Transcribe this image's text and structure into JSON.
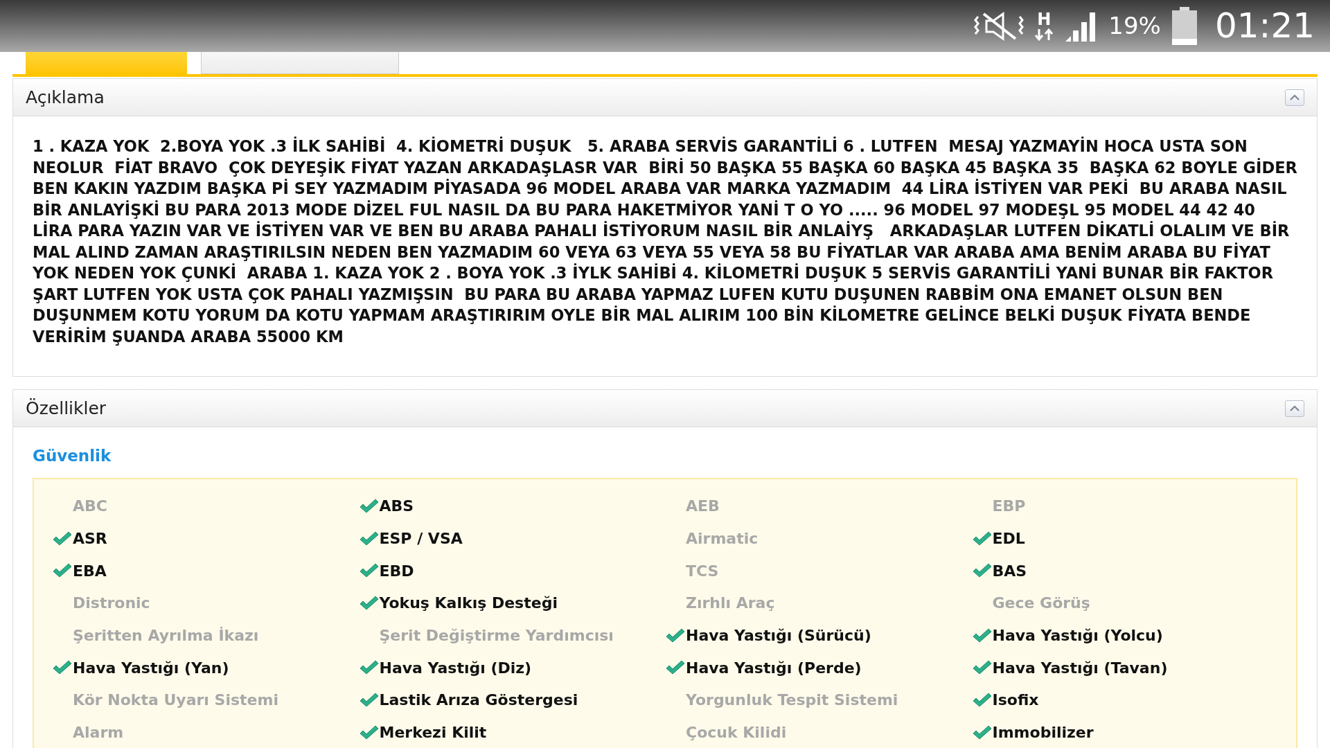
{
  "status_bar": {
    "network": "H",
    "battery": "19%",
    "time": "01:21"
  },
  "tabs": [
    {
      "selected": true
    },
    {
      "selected": false
    }
  ],
  "description": {
    "title": "Açıklama",
    "expanded": true,
    "text": "1 . KAZA YOK  2.BOYA YOK .3 İLK SAHİBİ  4. KİOMETRİ DUŞUK   5. ARABA SERVİS GARANTİLİ 6 . LUTFEN  MESAJ YAZMAYİN HOCA USTA SON NEOLUR  FİAT BRAVO  ÇOK DEYEŞİK FİYAT YAZAN ARKADAŞLASR VAR  BİRİ 50 BAŞKA 55 BAŞKA 60 BAŞKA 45 BAŞKA 35  BAŞKA 62 BOYLE GİDER BEN KAKIN YAZDIM BAŞKA Pİ SEY YAZMADIM PİYASADA 96 MODEL ARABA VAR MARKA YAZMADIM  44 LİRA İSTİYEN VAR PEKİ  BU ARABA NASIL BİR ANLAYİŞKİ BU PARA 2013 MODE DİZEL FUL NASIL DA BU PARA HAKETMİYOR YANİ T O YO ..... 96 MODEL 97 MODEŞL 95 MODEL 44 42 40 LİRA PARA YAZIN VAR VE İSTİYEN VAR VE BEN BU ARABA PAHALI İSTİYORUM NASIL BİR ANLAİYŞ   ARKADAŞLAR LUTFEN DİKATLİ OLALIM VE BİR MAL ALIND ZAMAN ARAŞTIRILSIN NEDEN BEN YAZMADIM 60 VEYA 63 VEYA 55 VEYA 58 BU FİYATLAR VAR ARABA AMA BENİM ARABA BU FİYAT YOK NEDEN YOK ÇUNKİ  ARABA 1. KAZA YOK 2 . BOYA YOK .3 İYLK SAHİBİ 4. KİLOMETRİ DUŞUK 5 SERVİS GARANTİLİ YANİ BUNAR BİR FAKTOR ŞART LUTFEN YOK USTA ÇOK PAHALI YAZMIŞSIN  BU PARA BU ARABA YAPMAZ LUFEN KUTU DUŞUNEN RABBİM ONA EMANET OLSUN BEN DUŞUNMEM KOTU YORUM DA KOTU YAPMAM ARAŞTIRIRIM OYLE BİR MAL ALIRIM 100 BİN KİLOMETRE GELİNCE BELKİ DUŞUK FİYATA BENDE VERİRİM ŞUANDA ARABA 55000 KM"
  },
  "features": {
    "title": "Özellikler",
    "expanded": true,
    "group": "Güvenlik",
    "items": [
      {
        "label": "ABC",
        "checked": false
      },
      {
        "label": "ABS",
        "checked": true
      },
      {
        "label": "AEB",
        "checked": false
      },
      {
        "label": "EBP",
        "checked": false
      },
      {
        "label": "ASR",
        "checked": true
      },
      {
        "label": "ESP / VSA",
        "checked": true
      },
      {
        "label": "Airmatic",
        "checked": false
      },
      {
        "label": "EDL",
        "checked": true
      },
      {
        "label": "EBA",
        "checked": true
      },
      {
        "label": "EBD",
        "checked": true
      },
      {
        "label": "TCS",
        "checked": false
      },
      {
        "label": "BAS",
        "checked": true
      },
      {
        "label": "Distronic",
        "checked": false
      },
      {
        "label": "Yokuş Kalkış Desteği",
        "checked": true
      },
      {
        "label": "Zırhlı Araç",
        "checked": false
      },
      {
        "label": "Gece Görüş",
        "checked": false
      },
      {
        "label": "Şeritten Ayrılma İkazı",
        "checked": false
      },
      {
        "label": "Şerit Değiştirme Yardımcısı",
        "checked": false
      },
      {
        "label": "Hava Yastığı (Sürücü)",
        "checked": true
      },
      {
        "label": "Hava Yastığı (Yolcu)",
        "checked": true
      },
      {
        "label": "Hava Yastığı (Yan)",
        "checked": true
      },
      {
        "label": "Hava Yastığı (Diz)",
        "checked": true
      },
      {
        "label": "Hava Yastığı (Perde)",
        "checked": true
      },
      {
        "label": "Hava Yastığı (Tavan)",
        "checked": true
      },
      {
        "label": "Kör Nokta Uyarı Sistemi",
        "checked": false
      },
      {
        "label": "Lastik Arıza Göstergesi",
        "checked": true
      },
      {
        "label": "Yorgunluk Tespit Sistemi",
        "checked": false
      },
      {
        "label": "Isofix",
        "checked": true
      },
      {
        "label": "Alarm",
        "checked": false
      },
      {
        "label": "Merkezi Kilit",
        "checked": true
      },
      {
        "label": "Çocuk Kilidi",
        "checked": false
      },
      {
        "label": "Immobilizer",
        "checked": true
      }
    ]
  }
}
